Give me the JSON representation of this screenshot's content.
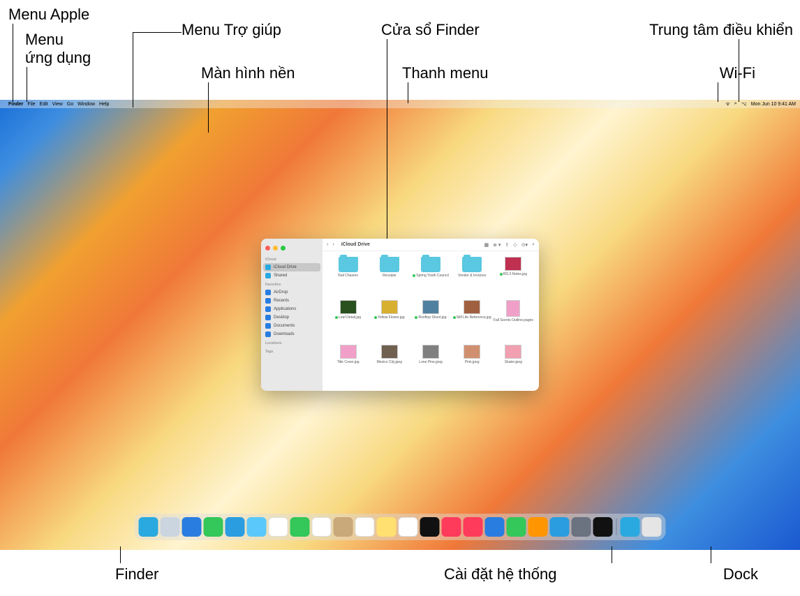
{
  "callouts": {
    "apple": "Menu Apple",
    "app": "Menu ứng dụng",
    "help": "Menu Trợ giúp",
    "desktop": "Màn hình nền",
    "finder_win": "Cửa sổ Finder",
    "menubar": "Thanh menu",
    "control": "Trung tâm điều khiển",
    "wifi": "Wi-Fi",
    "finder": "Finder",
    "settings": "Cài đặt hệ thống",
    "dock": "Dock"
  },
  "menubar": {
    "apple": "",
    "app": "Finder",
    "items": [
      "File",
      "Edit",
      "View",
      "Go",
      "Window",
      "Help"
    ],
    "datetime": "Mon Jun 10  9:41 AM"
  },
  "finder": {
    "title": "iCloud Drive",
    "sidebar": {
      "icloud_head": "iCloud",
      "icloud_items": [
        "iCloud Drive",
        "Shared"
      ],
      "fav_head": "Favorites",
      "fav_items": [
        "AirDrop",
        "Recents",
        "Applications",
        "Desktop",
        "Documents",
        "Downloads"
      ],
      "loc_head": "Locations",
      "tags_head": "Tags"
    },
    "files": [
      {
        "name": "Rail Chasers",
        "type": "folder"
      },
      {
        "name": "Receipts",
        "type": "folder"
      },
      {
        "name": "Spring Youth Council",
        "type": "folder",
        "dot": true
      },
      {
        "name": "Vendor & Invoices",
        "type": "folder"
      },
      {
        "name": "RD.2-Notes.jpg",
        "type": "img",
        "dot": true
      },
      {
        "name": "Leaf Detail.jpg",
        "type": "img",
        "dot": true
      },
      {
        "name": "Yellow Flower.jpg",
        "type": "img",
        "dot": true
      },
      {
        "name": "Rooftop Shoot.jpg",
        "type": "img",
        "dot": true
      },
      {
        "name": "Still Life Reference.jpg",
        "type": "img",
        "dot": true
      },
      {
        "name": "Fall Scents Outline.pages",
        "type": "doc"
      },
      {
        "name": "Title Cover.jpg",
        "type": "img"
      },
      {
        "name": "Mexico City.jpeg",
        "type": "img"
      },
      {
        "name": "Lone Pine.jpeg",
        "type": "img"
      },
      {
        "name": "Pink.jpeg",
        "type": "img"
      },
      {
        "name": "Skater.jpeg",
        "type": "img"
      }
    ]
  },
  "sb_colors": [
    "#2aa9e0",
    "#2aa9e0",
    "#2a7de0",
    "#2a7de0",
    "#2a7de0",
    "#2a7de0",
    "#2a7de0",
    "#2a7de0"
  ],
  "dock": [
    {
      "name": "finder",
      "color": "#2aa9e0"
    },
    {
      "name": "launchpad",
      "color": "#cbd5e0"
    },
    {
      "name": "safari",
      "color": "#2a7de0"
    },
    {
      "name": "messages",
      "color": "#34c759"
    },
    {
      "name": "mail",
      "color": "#2a9de0"
    },
    {
      "name": "maps",
      "color": "#5ac8fa"
    },
    {
      "name": "photos",
      "color": "#fff"
    },
    {
      "name": "facetime",
      "color": "#34c759"
    },
    {
      "name": "calendar",
      "color": "#fff"
    },
    {
      "name": "contacts",
      "color": "#c9a87a"
    },
    {
      "name": "reminders",
      "color": "#fff"
    },
    {
      "name": "notes",
      "color": "#ffe070"
    },
    {
      "name": "freeform",
      "color": "#fff"
    },
    {
      "name": "tv",
      "color": "#111"
    },
    {
      "name": "music",
      "color": "#ff3b5c"
    },
    {
      "name": "news",
      "color": "#ff3b5c"
    },
    {
      "name": "keynote",
      "color": "#2a7de0"
    },
    {
      "name": "numbers",
      "color": "#34c759"
    },
    {
      "name": "pages",
      "color": "#ff9500"
    },
    {
      "name": "appstore",
      "color": "#2a9de0"
    },
    {
      "name": "settings",
      "color": "#6b7280"
    },
    {
      "name": "iphone-mirror",
      "color": "#111"
    }
  ],
  "dock_right": [
    {
      "name": "downloads",
      "color": "#2aa9e0"
    },
    {
      "name": "trash",
      "color": "#e5e5e5"
    }
  ],
  "img_colors": [
    "#c03050",
    "#2a5020",
    "#d8b030",
    "#5080a0",
    "#a06040",
    "#f0a0c8",
    "#706050",
    "#808080",
    "#d09070",
    "#f0a0b0",
    "#604030"
  ]
}
